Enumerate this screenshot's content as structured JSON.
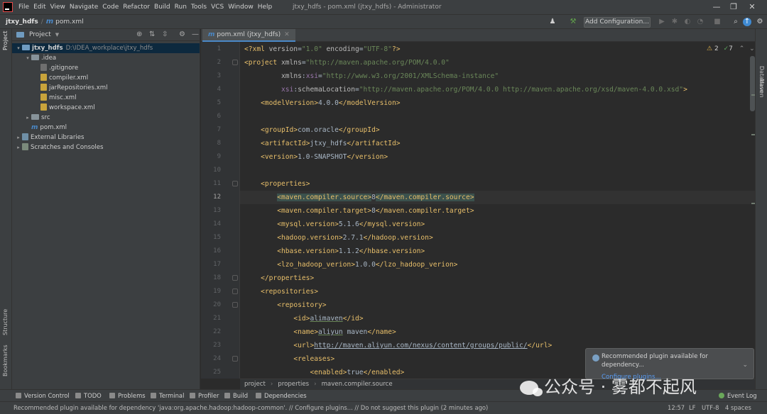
{
  "window": {
    "menus": [
      "File",
      "Edit",
      "View",
      "Navigate",
      "Code",
      "Refactor",
      "Build",
      "Run",
      "Tools",
      "VCS",
      "Window",
      "Help"
    ],
    "title": "jtxy_hdfs - pom.xml (jtxy_hdfs) - Administrator",
    "min": "—",
    "max": "❐",
    "close": "✕"
  },
  "navbar": {
    "project": "jtxy_hdfs",
    "file_icon": "m",
    "file": "pom.xml",
    "add_config": "Add Configuration...",
    "icons": [
      "user-icon",
      "hammer-icon",
      "run-icon",
      "debug-icon",
      "coverage-icon",
      "profile-icon",
      "stop-icon",
      "search-icon",
      "update-icon",
      "settings-icon"
    ]
  },
  "left_stripe": {
    "project": "Project",
    "structure": "Structure",
    "bookmarks": "Bookmarks"
  },
  "right_stripe": {
    "database": "Database",
    "maven": "Maven"
  },
  "project_panel": {
    "header": "Project",
    "tree": [
      {
        "label": "jtxy_hdfs",
        "hint": "D:\\IDEA_workplace\\jtxy_hdfs",
        "depth": 0,
        "arrow": "▾",
        "icon": "folder-blue",
        "selected": true
      },
      {
        "label": ".idea",
        "depth": 1,
        "arrow": "▾",
        "icon": "folder"
      },
      {
        "label": ".gitignore",
        "depth": 2,
        "icon": "git"
      },
      {
        "label": "compiler.xml",
        "depth": 2,
        "icon": "xml"
      },
      {
        "label": "jarRepositories.xml",
        "depth": 2,
        "icon": "xml"
      },
      {
        "label": "misc.xml",
        "depth": 2,
        "icon": "xml"
      },
      {
        "label": "workspace.xml",
        "depth": 2,
        "icon": "xml"
      },
      {
        "label": "src",
        "depth": 1,
        "arrow": "▸",
        "icon": "folder"
      },
      {
        "label": "pom.xml",
        "depth": 1,
        "icon": "maven"
      },
      {
        "label": "External Libraries",
        "depth": 0,
        "arrow": "▸",
        "icon": "lib"
      },
      {
        "label": "Scratches and Consoles",
        "depth": 0,
        "arrow": "▸",
        "icon": "scratch"
      }
    ]
  },
  "editor": {
    "tab": "pom.xml (jtxy_hdfs)",
    "inspect_warnings": "2",
    "inspect_ok": "7",
    "current_line": 12,
    "lines": [
      {
        "n": "1",
        "indent": 0,
        "parts": [
          [
            "pi",
            "<?xml "
          ],
          [
            "an",
            "version"
          ],
          [
            "tx",
            "="
          ],
          [
            "av",
            "\"1.0\" "
          ],
          [
            "an",
            "encoding"
          ],
          [
            "tx",
            "="
          ],
          [
            "av",
            "\"UTF-8\""
          ],
          [
            "pi",
            "?>"
          ]
        ]
      },
      {
        "n": "2",
        "indent": 0,
        "parts": [
          [
            "tg",
            "<project "
          ],
          [
            "an",
            "xmlns"
          ],
          [
            "tx",
            "="
          ],
          [
            "av",
            "\"http://maven.apache.org/POM/4.0.0\""
          ]
        ]
      },
      {
        "n": "3",
        "indent": 9,
        "parts": [
          [
            "an",
            "xmlns"
          ],
          [
            "tx",
            ":"
          ],
          [
            "ns",
            "xsi"
          ],
          [
            "tx",
            "="
          ],
          [
            "av",
            "\"http://www.w3.org/2001/XMLSchema-instance\""
          ]
        ]
      },
      {
        "n": "4",
        "indent": 9,
        "parts": [
          [
            "ns",
            "xsi"
          ],
          [
            "tx",
            ":"
          ],
          [
            "an",
            "schemaLocation"
          ],
          [
            "tx",
            "="
          ],
          [
            "av",
            "\"http://maven.apache.org/POM/4.0.0 http://maven.apache.org/xsd/maven-4.0.0.xsd\""
          ],
          [
            "tg",
            ">"
          ]
        ]
      },
      {
        "n": "5",
        "indent": 4,
        "parts": [
          [
            "tg",
            "<modelVersion>"
          ],
          [
            "tx",
            "4.0.0"
          ],
          [
            "tg",
            "</modelVersion>"
          ]
        ]
      },
      {
        "n": "6",
        "indent": 0,
        "parts": []
      },
      {
        "n": "7",
        "indent": 4,
        "parts": [
          [
            "tg",
            "<groupId>"
          ],
          [
            "tx",
            "com.oracle"
          ],
          [
            "tg",
            "</groupId>"
          ]
        ]
      },
      {
        "n": "8",
        "indent": 4,
        "parts": [
          [
            "tg",
            "<artifactId>"
          ],
          [
            "tx",
            "jtxy_hdfs"
          ],
          [
            "tg",
            "</artifactId>"
          ]
        ]
      },
      {
        "n": "9",
        "indent": 4,
        "parts": [
          [
            "tg",
            "<version>"
          ],
          [
            "tx",
            "1.0-SNAPSHOT"
          ],
          [
            "tg",
            "</version>"
          ]
        ]
      },
      {
        "n": "10",
        "indent": 0,
        "parts": []
      },
      {
        "n": "11",
        "indent": 4,
        "parts": [
          [
            "tg",
            "<properties>"
          ]
        ]
      },
      {
        "n": "12",
        "indent": 8,
        "parts": [
          [
            "tgm",
            "<maven.compiler.source>"
          ],
          [
            "tx",
            "8"
          ],
          [
            "tgm",
            "</maven.compiler.source>"
          ]
        ]
      },
      {
        "n": "13",
        "indent": 8,
        "parts": [
          [
            "tg",
            "<maven.compiler.target>"
          ],
          [
            "tx",
            "8"
          ],
          [
            "tg",
            "</maven.compiler.target>"
          ]
        ]
      },
      {
        "n": "14",
        "indent": 8,
        "parts": [
          [
            "tg",
            "<mysql.version>"
          ],
          [
            "tx",
            "5.1.6"
          ],
          [
            "tg",
            "</mysql.version>"
          ]
        ]
      },
      {
        "n": "15",
        "indent": 8,
        "parts": [
          [
            "tg",
            "<hadoop.version>"
          ],
          [
            "tx",
            "2.7.1"
          ],
          [
            "tg",
            "</hadoop.version>"
          ]
        ]
      },
      {
        "n": "16",
        "indent": 8,
        "parts": [
          [
            "tg",
            "<hbase.version>"
          ],
          [
            "tx",
            "1.1.2"
          ],
          [
            "tg",
            "</hbase.version>"
          ]
        ]
      },
      {
        "n": "17",
        "indent": 8,
        "parts": [
          [
            "tg",
            "<lzo_hadoop_verion>"
          ],
          [
            "tx",
            "1.0.0"
          ],
          [
            "tg",
            "</lzo_hadoop_verion>"
          ]
        ]
      },
      {
        "n": "18",
        "indent": 4,
        "parts": [
          [
            "tg",
            "</properties>"
          ]
        ]
      },
      {
        "n": "19",
        "indent": 4,
        "parts": [
          [
            "tg",
            "<repositories>"
          ]
        ]
      },
      {
        "n": "20",
        "indent": 8,
        "parts": [
          [
            "tg",
            "<repository>"
          ]
        ]
      },
      {
        "n": "21",
        "indent": 12,
        "parts": [
          [
            "tg",
            "<id>"
          ],
          [
            "txu",
            "alimaven"
          ],
          [
            "tg",
            "</id>"
          ]
        ]
      },
      {
        "n": "22",
        "indent": 12,
        "parts": [
          [
            "tg",
            "<name>"
          ],
          [
            "txu",
            "aliyun"
          ],
          [
            "tx",
            " maven"
          ],
          [
            "tg",
            "</name>"
          ]
        ]
      },
      {
        "n": "23",
        "indent": 12,
        "parts": [
          [
            "tg",
            "<url>"
          ],
          [
            "txl",
            "http://maven.aliyun.com/nexus/content/groups/public/"
          ],
          [
            "tg",
            "</url>"
          ]
        ]
      },
      {
        "n": "24",
        "indent": 12,
        "parts": [
          [
            "tg",
            "<releases>"
          ]
        ]
      },
      {
        "n": "25",
        "indent": 16,
        "parts": [
          [
            "tg",
            "<enabled>"
          ],
          [
            "tx",
            "true"
          ],
          [
            "tg",
            "</enabled>"
          ]
        ]
      }
    ]
  },
  "breadcrumb": [
    "project",
    "properties",
    "maven.compiler.source"
  ],
  "bottom_tools": [
    {
      "label": "Version Control",
      "icon": "branch-icon"
    },
    {
      "label": "TODO",
      "icon": "list-icon"
    },
    {
      "label": "Problems",
      "icon": "warning-icon"
    },
    {
      "label": "Terminal",
      "icon": "terminal-icon"
    },
    {
      "label": "Profiler",
      "icon": "profiler-icon"
    },
    {
      "label": "Build",
      "icon": "hammer-icon"
    },
    {
      "label": "Dependencies",
      "icon": "layers-icon"
    }
  ],
  "event_log": "Event Log",
  "status": {
    "message": "Recommended plugin available for dependency 'java:org.apache.hadoop:hadoop-common'. // Configure plugins... // Do not suggest this plugin (2 minutes ago)",
    "position": "12:57",
    "line_sep": "LF",
    "encoding": "UTF-8",
    "indent": "4 spaces"
  },
  "notification": {
    "text": "Recommended plugin available for dependency...",
    "link": "Configure plugins..."
  },
  "watermark": "公众号 · 雾都不起风"
}
